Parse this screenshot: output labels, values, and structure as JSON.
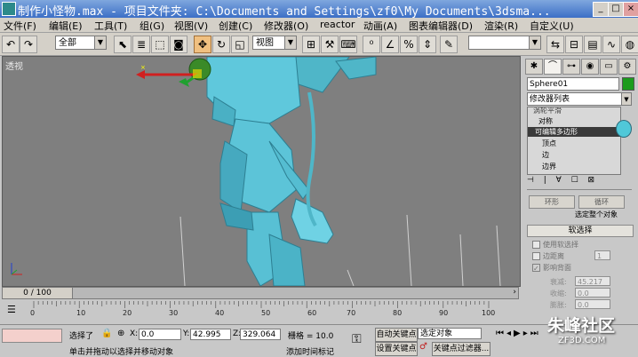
{
  "window": {
    "title": "制作小怪物.max   - 项目文件夹: C:\\Documents and Settings\\zf0\\My Documents\\3dsma...",
    "minimize": "_",
    "maximize": "□",
    "close": "×"
  },
  "menu": [
    "文件(F)",
    "编辑(E)",
    "工具(T)",
    "组(G)",
    "视图(V)",
    "创建(C)",
    "修改器(O)",
    "reactor",
    "动画(A)",
    "图表编辑器(D)",
    "渲染(R)",
    "自定义(U)"
  ],
  "toolbar": {
    "selection_filter": "全部",
    "reference_coord": "视图"
  },
  "viewport": {
    "label": "透视"
  },
  "command_panel": {
    "object_name": "Sphere01",
    "modifier_list": "修改器列表",
    "stack": {
      "item_0": "涡轮平滑",
      "item_1": "对称",
      "item_2": "可编辑多边形",
      "item_3": "顶点",
      "item_4": "边",
      "item_5": "边界"
    },
    "ring_button": "环形",
    "loop_button": "循环",
    "select_whole": "选定整个对象",
    "soft_selection": "软选择",
    "use_soft": "使用软选择",
    "edge_distance": "边距离",
    "edge_distance_value": "1",
    "affect_backfacing": "影响背面",
    "falloff_label": "衰减:",
    "falloff_value": "45.217",
    "pinch_label": "收缩:",
    "pinch_value": "0.0",
    "bubble_label": "膨胀:",
    "bubble_value": "0.0"
  },
  "timeline": {
    "frame_display": "0 / 100",
    "ticks": [
      "0",
      "10",
      "20",
      "30",
      "40",
      "50",
      "60",
      "70",
      "80",
      "90",
      "100"
    ]
  },
  "status": {
    "selected": "选择了",
    "x_label": "X:",
    "x_value": "0.0",
    "y_label": "Y:",
    "y_value": "42.995",
    "z_label": "Z:",
    "z_value": "329.064",
    "grid": "栅格 = 10.0",
    "auto_key": "自动关键点",
    "selected_obj": "选定对象",
    "set_key": "设置关键点",
    "key_filters": "关键点过滤器...",
    "prompt": "单击并拖动以选择并移动对象",
    "add_time_tag": "添加时间标记"
  },
  "watermark": {
    "main": "朱峰社区",
    "sub": "ZF3D.COM"
  }
}
